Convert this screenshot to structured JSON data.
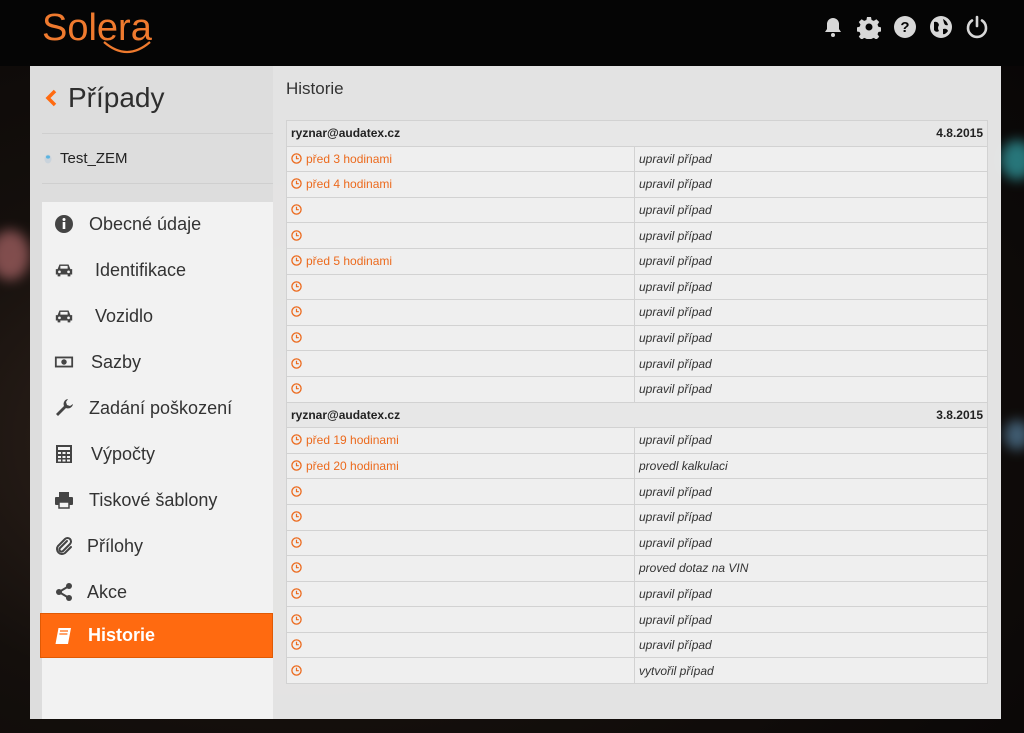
{
  "brand": {
    "logo_text": "Solera"
  },
  "colors": {
    "accent": "#ff6a10",
    "time_text": "#ec6a1d"
  },
  "topbar": {
    "icons": [
      "bell-icon",
      "gear-icon",
      "help-icon",
      "globe-icon",
      "power-icon"
    ]
  },
  "sidebar": {
    "title": "Případy",
    "case_name": "Test_ZEM",
    "items": [
      {
        "label": "Obecné údaje",
        "icon": "info-icon"
      },
      {
        "label": "Identifikace",
        "icon": "car-icon"
      },
      {
        "label": "Vozidlo",
        "icon": "car-icon"
      },
      {
        "label": "Sazby",
        "icon": "money-icon"
      },
      {
        "label": "Zadání poškození",
        "icon": "wrench-icon"
      },
      {
        "label": "Výpočty",
        "icon": "calculator-icon"
      },
      {
        "label": "Tiskové šablony",
        "icon": "printer-icon"
      },
      {
        "label": "Přílohy",
        "icon": "paperclip-icon"
      },
      {
        "label": "Akce",
        "icon": "share-icon"
      },
      {
        "label": "Historie",
        "icon": "book-icon",
        "active": true
      }
    ]
  },
  "main": {
    "title": "Historie",
    "groups": [
      {
        "user": "ryznar@audatex.cz",
        "date": "4.8.2015",
        "rows": [
          {
            "time": "před 3 hodinami",
            "action": "upravil případ"
          },
          {
            "time": "před 4 hodinami",
            "action": "upravil případ"
          },
          {
            "time": "",
            "action": "upravil případ"
          },
          {
            "time": "",
            "action": "upravil případ"
          },
          {
            "time": "před 5 hodinami",
            "action": "upravil případ"
          },
          {
            "time": "",
            "action": "upravil případ"
          },
          {
            "time": "",
            "action": "upravil případ"
          },
          {
            "time": "",
            "action": "upravil případ"
          },
          {
            "time": "",
            "action": "upravil případ"
          },
          {
            "time": "",
            "action": "upravil případ"
          }
        ]
      },
      {
        "user": "ryznar@audatex.cz",
        "date": "3.8.2015",
        "rows": [
          {
            "time": "před 19 hodinami",
            "action": "upravil případ"
          },
          {
            "time": "před 20 hodinami",
            "action": "provedl kalkulaci"
          },
          {
            "time": "",
            "action": "upravil případ"
          },
          {
            "time": "",
            "action": "upravil případ"
          },
          {
            "time": "",
            "action": "upravil případ"
          },
          {
            "time": "",
            "action": "proved dotaz na VIN"
          },
          {
            "time": "",
            "action": "upravil případ"
          },
          {
            "time": "",
            "action": "upravil případ"
          },
          {
            "time": "",
            "action": "upravil případ"
          },
          {
            "time": "",
            "action": "vytvořil případ"
          }
        ]
      }
    ]
  }
}
